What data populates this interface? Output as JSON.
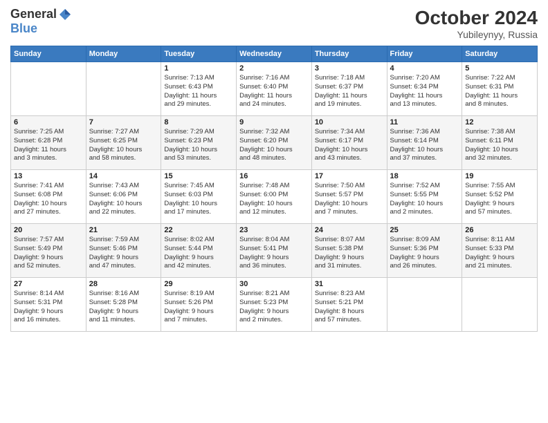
{
  "header": {
    "logo_general": "General",
    "logo_blue": "Blue",
    "month_year": "October 2024",
    "location": "Yubileynyy, Russia"
  },
  "weekdays": [
    "Sunday",
    "Monday",
    "Tuesday",
    "Wednesday",
    "Thursday",
    "Friday",
    "Saturday"
  ],
  "weeks": [
    [
      {
        "day": "",
        "info": ""
      },
      {
        "day": "",
        "info": ""
      },
      {
        "day": "1",
        "info": "Sunrise: 7:13 AM\nSunset: 6:43 PM\nDaylight: 11 hours\nand 29 minutes."
      },
      {
        "day": "2",
        "info": "Sunrise: 7:16 AM\nSunset: 6:40 PM\nDaylight: 11 hours\nand 24 minutes."
      },
      {
        "day": "3",
        "info": "Sunrise: 7:18 AM\nSunset: 6:37 PM\nDaylight: 11 hours\nand 19 minutes."
      },
      {
        "day": "4",
        "info": "Sunrise: 7:20 AM\nSunset: 6:34 PM\nDaylight: 11 hours\nand 13 minutes."
      },
      {
        "day": "5",
        "info": "Sunrise: 7:22 AM\nSunset: 6:31 PM\nDaylight: 11 hours\nand 8 minutes."
      }
    ],
    [
      {
        "day": "6",
        "info": "Sunrise: 7:25 AM\nSunset: 6:28 PM\nDaylight: 11 hours\nand 3 minutes."
      },
      {
        "day": "7",
        "info": "Sunrise: 7:27 AM\nSunset: 6:25 PM\nDaylight: 10 hours\nand 58 minutes."
      },
      {
        "day": "8",
        "info": "Sunrise: 7:29 AM\nSunset: 6:23 PM\nDaylight: 10 hours\nand 53 minutes."
      },
      {
        "day": "9",
        "info": "Sunrise: 7:32 AM\nSunset: 6:20 PM\nDaylight: 10 hours\nand 48 minutes."
      },
      {
        "day": "10",
        "info": "Sunrise: 7:34 AM\nSunset: 6:17 PM\nDaylight: 10 hours\nand 43 minutes."
      },
      {
        "day": "11",
        "info": "Sunrise: 7:36 AM\nSunset: 6:14 PM\nDaylight: 10 hours\nand 37 minutes."
      },
      {
        "day": "12",
        "info": "Sunrise: 7:38 AM\nSunset: 6:11 PM\nDaylight: 10 hours\nand 32 minutes."
      }
    ],
    [
      {
        "day": "13",
        "info": "Sunrise: 7:41 AM\nSunset: 6:08 PM\nDaylight: 10 hours\nand 27 minutes."
      },
      {
        "day": "14",
        "info": "Sunrise: 7:43 AM\nSunset: 6:06 PM\nDaylight: 10 hours\nand 22 minutes."
      },
      {
        "day": "15",
        "info": "Sunrise: 7:45 AM\nSunset: 6:03 PM\nDaylight: 10 hours\nand 17 minutes."
      },
      {
        "day": "16",
        "info": "Sunrise: 7:48 AM\nSunset: 6:00 PM\nDaylight: 10 hours\nand 12 minutes."
      },
      {
        "day": "17",
        "info": "Sunrise: 7:50 AM\nSunset: 5:57 PM\nDaylight: 10 hours\nand 7 minutes."
      },
      {
        "day": "18",
        "info": "Sunrise: 7:52 AM\nSunset: 5:55 PM\nDaylight: 10 hours\nand 2 minutes."
      },
      {
        "day": "19",
        "info": "Sunrise: 7:55 AM\nSunset: 5:52 PM\nDaylight: 9 hours\nand 57 minutes."
      }
    ],
    [
      {
        "day": "20",
        "info": "Sunrise: 7:57 AM\nSunset: 5:49 PM\nDaylight: 9 hours\nand 52 minutes."
      },
      {
        "day": "21",
        "info": "Sunrise: 7:59 AM\nSunset: 5:46 PM\nDaylight: 9 hours\nand 47 minutes."
      },
      {
        "day": "22",
        "info": "Sunrise: 8:02 AM\nSunset: 5:44 PM\nDaylight: 9 hours\nand 42 minutes."
      },
      {
        "day": "23",
        "info": "Sunrise: 8:04 AM\nSunset: 5:41 PM\nDaylight: 9 hours\nand 36 minutes."
      },
      {
        "day": "24",
        "info": "Sunrise: 8:07 AM\nSunset: 5:38 PM\nDaylight: 9 hours\nand 31 minutes."
      },
      {
        "day": "25",
        "info": "Sunrise: 8:09 AM\nSunset: 5:36 PM\nDaylight: 9 hours\nand 26 minutes."
      },
      {
        "day": "26",
        "info": "Sunrise: 8:11 AM\nSunset: 5:33 PM\nDaylight: 9 hours\nand 21 minutes."
      }
    ],
    [
      {
        "day": "27",
        "info": "Sunrise: 8:14 AM\nSunset: 5:31 PM\nDaylight: 9 hours\nand 16 minutes."
      },
      {
        "day": "28",
        "info": "Sunrise: 8:16 AM\nSunset: 5:28 PM\nDaylight: 9 hours\nand 11 minutes."
      },
      {
        "day": "29",
        "info": "Sunrise: 8:19 AM\nSunset: 5:26 PM\nDaylight: 9 hours\nand 7 minutes."
      },
      {
        "day": "30",
        "info": "Sunrise: 8:21 AM\nSunset: 5:23 PM\nDaylight: 9 hours\nand 2 minutes."
      },
      {
        "day": "31",
        "info": "Sunrise: 8:23 AM\nSunset: 5:21 PM\nDaylight: 8 hours\nand 57 minutes."
      },
      {
        "day": "",
        "info": ""
      },
      {
        "day": "",
        "info": ""
      }
    ]
  ]
}
